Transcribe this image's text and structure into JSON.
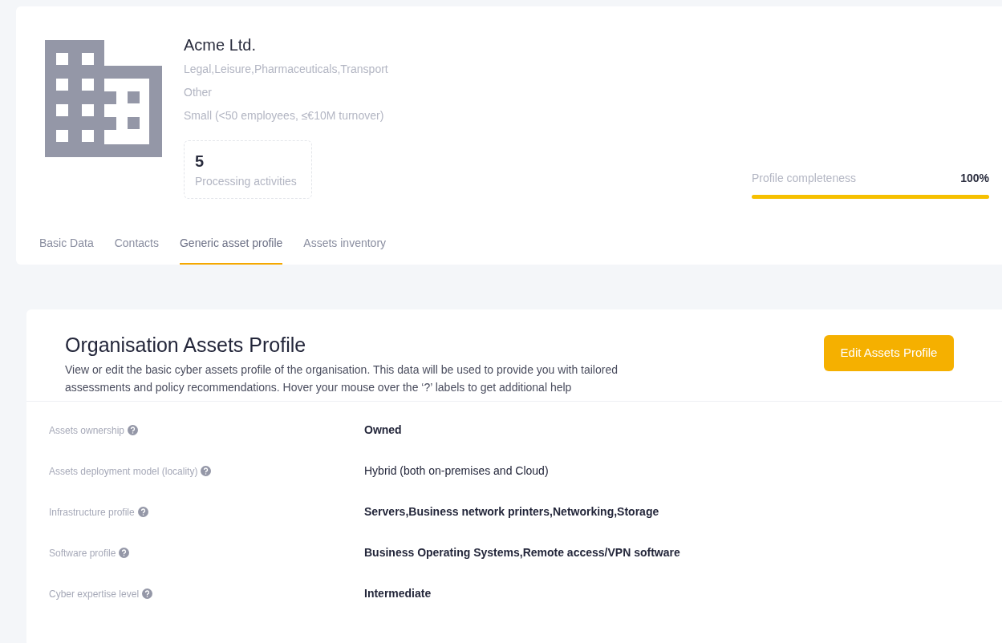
{
  "organisation": {
    "name": "Acme Ltd.",
    "details": [
      "Legal,Leisure,Pharmaceuticals,Transport",
      "Other",
      "Small (<50 employees, ≤€10M turnover)"
    ],
    "stat": {
      "value": "5",
      "label": "Processing activities"
    },
    "completeness": {
      "label": "Profile completeness",
      "reading": "100%",
      "level": 1
    }
  },
  "tabs": [
    {
      "label": "Basic Data",
      "selected": false
    },
    {
      "label": "Contacts",
      "selected": false
    },
    {
      "label": "Generic asset profile",
      "selected": true
    },
    {
      "label": "Assets inventory",
      "selected": false
    }
  ],
  "panel": {
    "title": "Organisation Assets Profile",
    "description": "View or edit the basic cyber assets profile of the organisation. This data will be used to provide you with tailored assessments and policy recommendations. Hover your mouse over the ‘?’ labels to get additional help",
    "button": "Edit Assets Profile",
    "fields": [
      {
        "label": "Assets ownership",
        "value": "Owned",
        "bold": true
      },
      {
        "label": "Assets deployment model (locality)",
        "value": "Hybrid (both on-premises and Cloud)",
        "bold": false
      },
      {
        "label": "Infrastructure profile",
        "value": "Servers,Business network printers,Networking,Storage",
        "bold": true
      },
      {
        "label": "Software profile",
        "value": "Business Operating Systems,Remote access/VPN software",
        "bold": true
      },
      {
        "label": "Cyber expertise level",
        "value": "Intermediate",
        "bold": true
      }
    ]
  }
}
